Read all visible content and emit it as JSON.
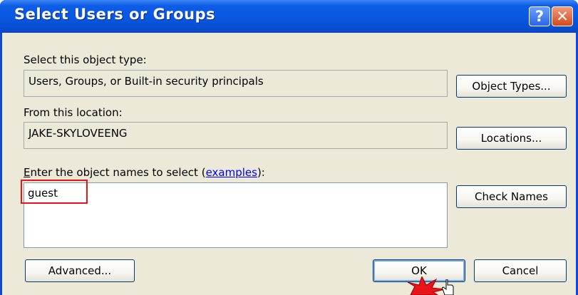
{
  "window": {
    "title": "Select Users or Groups",
    "help_glyph": "?",
    "close_glyph": "✕"
  },
  "object_type": {
    "label": "Select this object type:",
    "value": "Users, Groups, or Built-in security principals",
    "button": "Object Types..."
  },
  "location": {
    "label": "From this location:",
    "value": "JAKE-SKYLOVEENG",
    "button": "Locations..."
  },
  "names": {
    "label_prefix": "E",
    "label_rest": "nter the object names to select (",
    "link": "examples",
    "label_suffix": "):",
    "value": "guest",
    "check_button": "Check Names"
  },
  "buttons": {
    "advanced": "Advanced...",
    "ok": "OK",
    "cancel": "Cancel"
  },
  "icons": {
    "annotation": "red-starburst-icon",
    "pointer": "mouse-cursor-icon"
  },
  "colors": {
    "titlebar": "#0a58e2",
    "dialog_bg": "#ece9d8",
    "highlight": "#e8141a",
    "link": "#0000ff"
  }
}
